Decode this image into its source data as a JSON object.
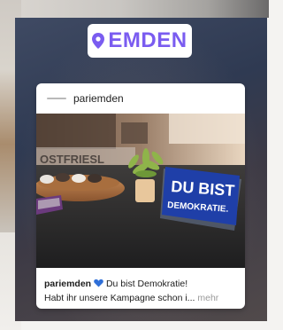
{
  "location": {
    "label": "EMDEN",
    "color": "#7a5cf0"
  },
  "post": {
    "username": "pariemden",
    "caption_user": "pariemden",
    "caption_line1": "Du bist Demokratie!",
    "caption_line2": "Habt ihr unsere Kampagne schon i...",
    "more_label": "mehr",
    "heart_icon": "blue-heart-icon",
    "heart_color": "#2f6fd8"
  },
  "photo": {
    "sign_line1": "DU BIST",
    "sign_line2": "DEMOKRATIE.",
    "shelf_text": "OSTFRIESL",
    "sign_color": "#1f3fa8"
  }
}
